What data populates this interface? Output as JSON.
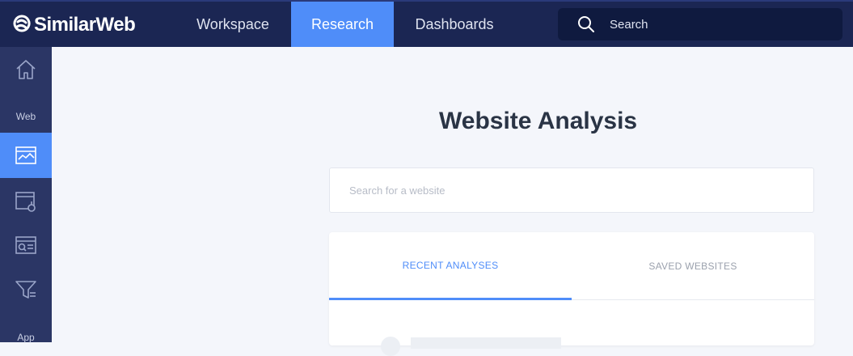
{
  "topbar": {
    "brand": "SimilarWeb",
    "nav": [
      {
        "label": "Workspace",
        "active": false
      },
      {
        "label": "Research",
        "active": true
      },
      {
        "label": "Dashboards",
        "active": false
      }
    ],
    "search_label": "Search"
  },
  "sidebar": {
    "items": [
      {
        "icon": "home-icon",
        "active": false
      },
      {
        "section_label": "Web"
      },
      {
        "icon": "website-analysis-icon",
        "active": true
      },
      {
        "icon": "segment-analysis-icon",
        "active": false
      },
      {
        "icon": "keyword-research-icon",
        "active": false
      },
      {
        "icon": "funnel-analysis-icon",
        "active": false
      },
      {
        "section_label": "App"
      }
    ]
  },
  "main": {
    "title": "Website Analysis",
    "search_placeholder": "Search for a website",
    "tabs": [
      {
        "label": "RECENT ANALYSES",
        "active": true
      },
      {
        "label": "SAVED WEBSITES",
        "active": false
      }
    ]
  },
  "colors": {
    "topbar_bg": "#1b2653",
    "accent": "#4f8df9",
    "sidebar_bg": "#2b3665",
    "page_bg": "#f4f6fb"
  }
}
